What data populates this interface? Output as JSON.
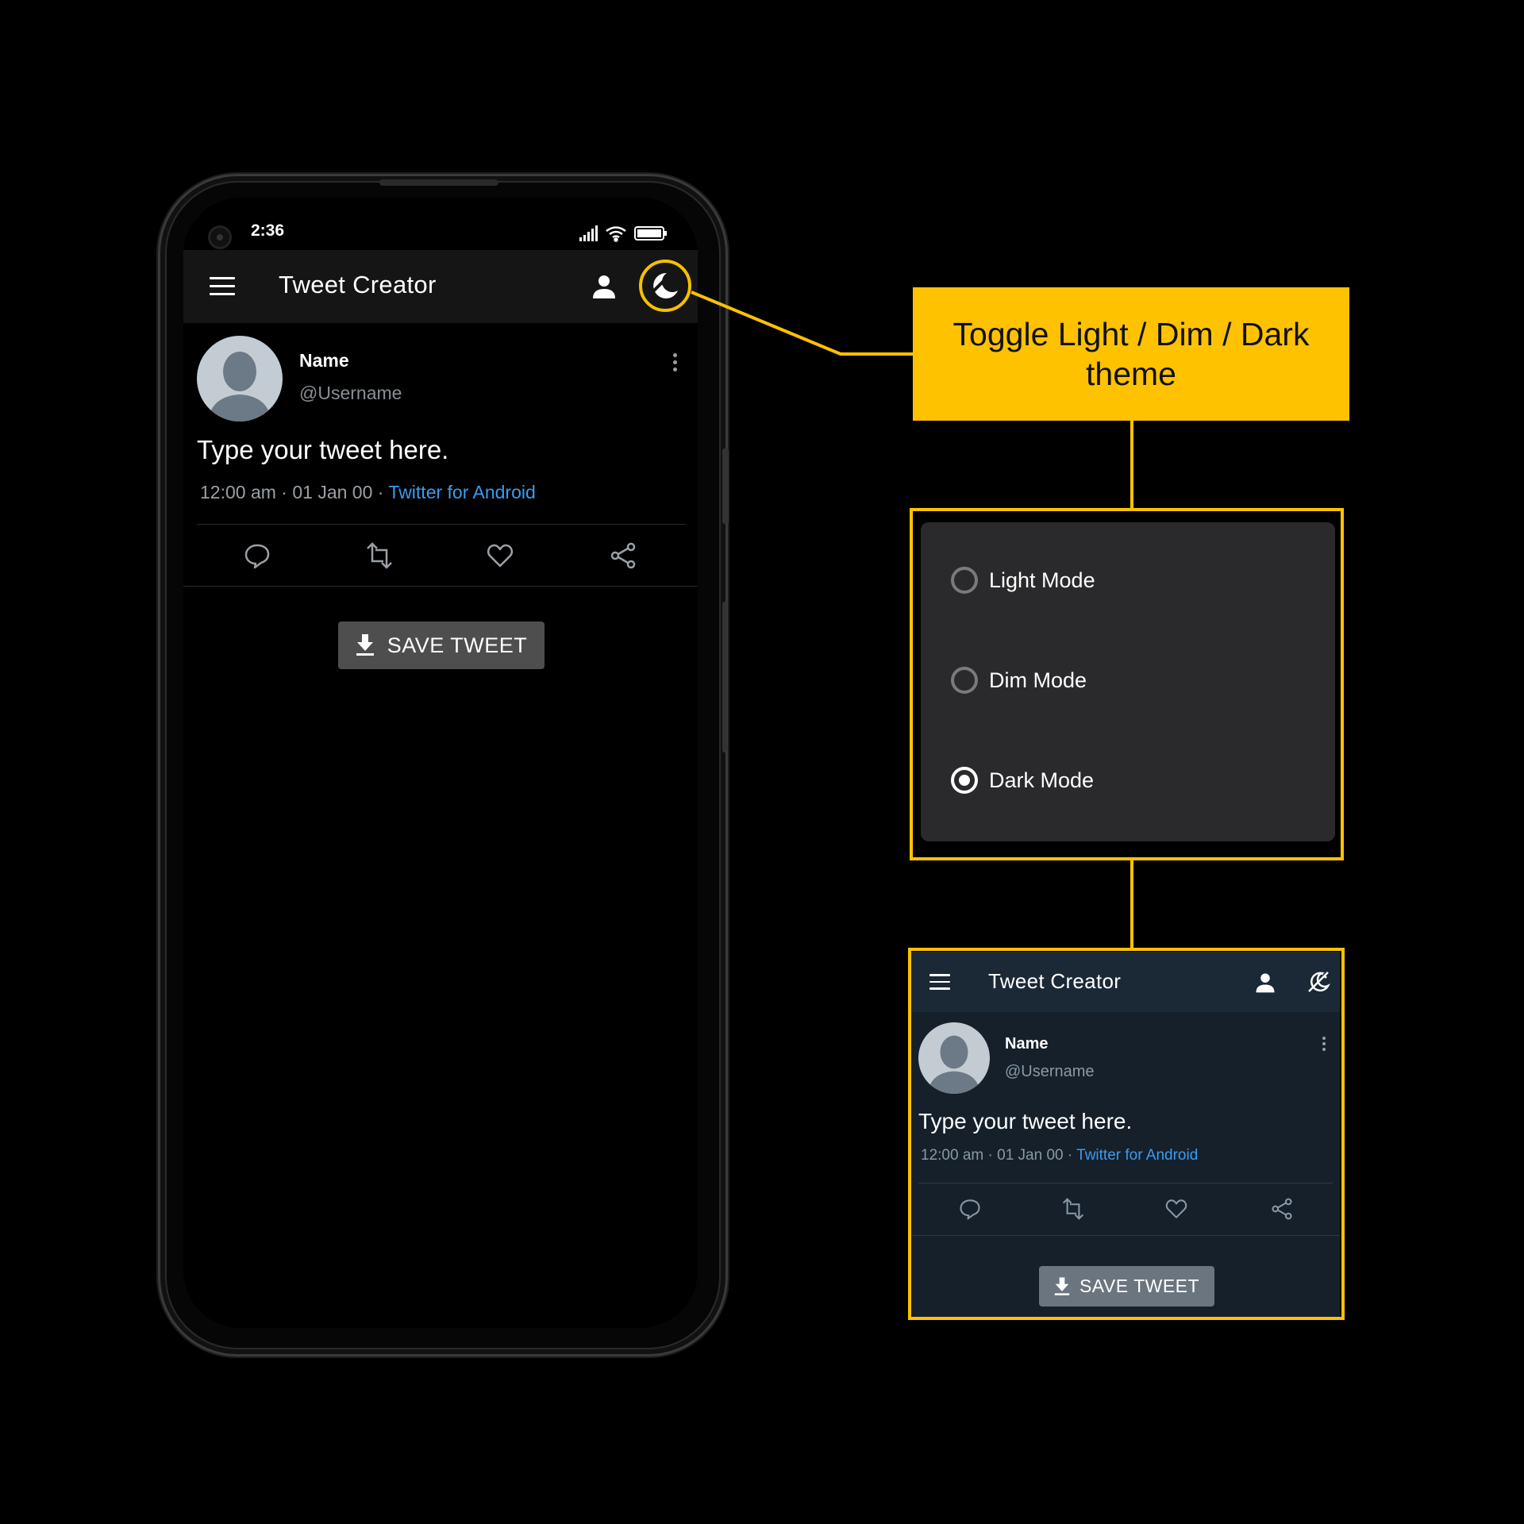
{
  "colors": {
    "accent": "#ffc200",
    "link": "#3b9cf0",
    "dark_bg": "#000000",
    "dim_bg": "#15202b"
  },
  "status": {
    "time": "2:36"
  },
  "app": {
    "title": "Tweet Creator"
  },
  "tweet": {
    "name": "Name",
    "username": "@Username",
    "text": "Type your tweet here.",
    "time": "12:00 am",
    "date": "01 Jan 00",
    "source": "Twitter for Android"
  },
  "save_button": {
    "label": "SAVE TWEET"
  },
  "callout": {
    "text": "Toggle Light / Dim / Dark theme"
  },
  "theme_dialog": {
    "options": [
      {
        "label": "Light Mode",
        "selected": false
      },
      {
        "label": "Dim Mode",
        "selected": false
      },
      {
        "label": "Dark Mode",
        "selected": true
      }
    ]
  },
  "dim_preview": {
    "app_title": "Tweet Creator",
    "name": "Name",
    "username": "@Username",
    "text": "Type your tweet here.",
    "time": "12:00 am",
    "date": "01 Jan 00",
    "source": "Twitter for Android",
    "save_label": "SAVE TWEET"
  },
  "icons": [
    "menu-icon",
    "person-icon",
    "theme-toggle-icon",
    "more-vert-icon",
    "reply-icon",
    "retweet-icon",
    "like-icon",
    "share-icon",
    "download-icon"
  ]
}
